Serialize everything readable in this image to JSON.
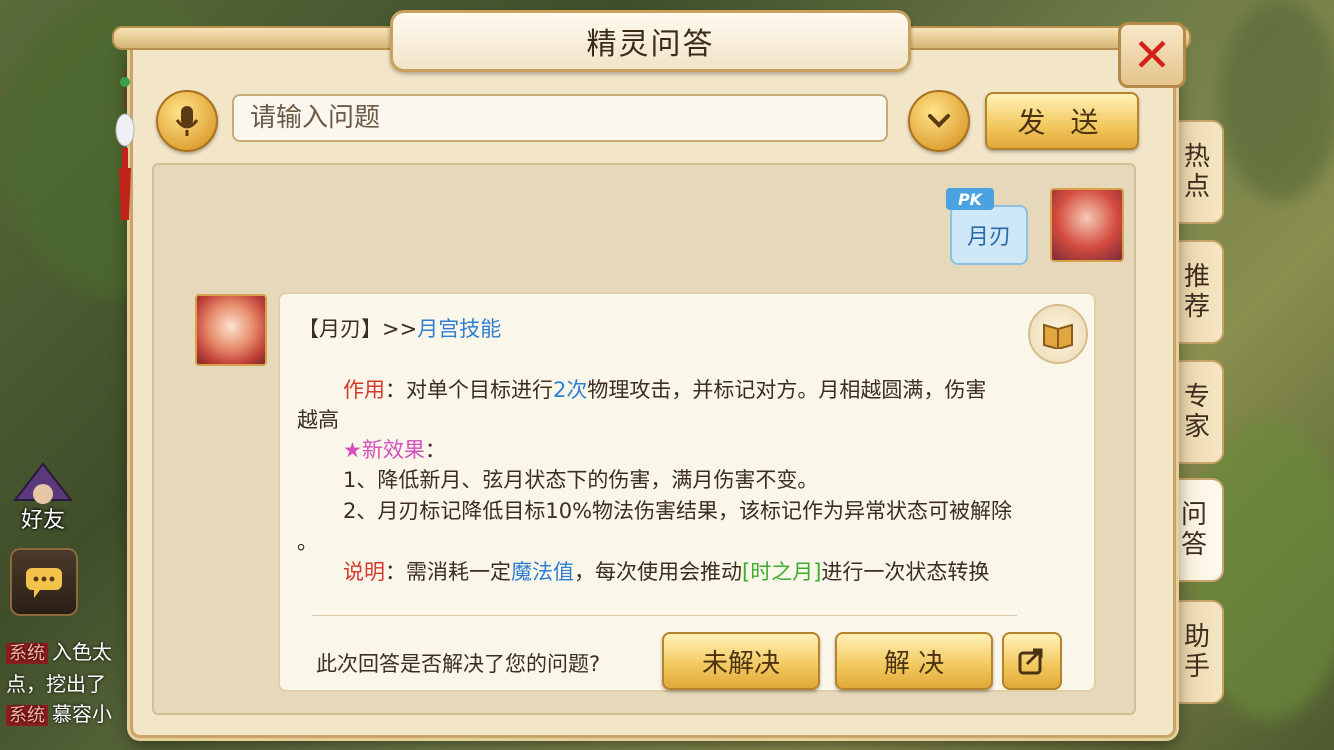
{
  "window": {
    "title": "精灵问答"
  },
  "search": {
    "placeholder": "请输入问题",
    "send_label": "发 送"
  },
  "user_message": {
    "tag": "PK",
    "text": "月刃"
  },
  "answer": {
    "head_prefix": "【月刃】>>",
    "head_link": "月宫技能",
    "effect_label": "作用",
    "effect_pre": "：对单个目标进行",
    "effect_count": "2次",
    "effect_post": "物理攻击，并标记对方。月相越圆满，伤害",
    "effect_wrap": "越高",
    "new_label": "★新效果",
    "new_colon": "：",
    "item1": "1、降低新月、弦月状态下的伤害，满月伤害不变。",
    "item2": "2、月刃标记降低目标10%物法伤害结果，该标记作为异常状态可被解除",
    "item2_wrap": "。",
    "note_label": "说明",
    "note_pre": "：需消耗一定",
    "note_link": "魔法值",
    "note_mid": "，每次使用会推动",
    "note_tag": "[时之月]",
    "note_post": "进行一次状态转换"
  },
  "feedback": {
    "question": "此次回答是否解决了您的问题?",
    "unresolved": "未解决",
    "resolved": "解 决"
  },
  "side_tabs": [
    {
      "label": "热点"
    },
    {
      "label": "推荐"
    },
    {
      "label": "专家"
    },
    {
      "label": "问答"
    },
    {
      "label": "助手"
    }
  ],
  "hud": {
    "friends": "好友",
    "sys_tag": "系统",
    "sys_line1": "入色太",
    "sys_line2": "点，挖出了",
    "sys_line3": "慕容小"
  },
  "colors": {
    "accent": "#2e7fd1",
    "warn": "#d43a2b",
    "highlight": "#d44fc0",
    "bracket": "#3cae2f"
  },
  "active_tab": "问答"
}
